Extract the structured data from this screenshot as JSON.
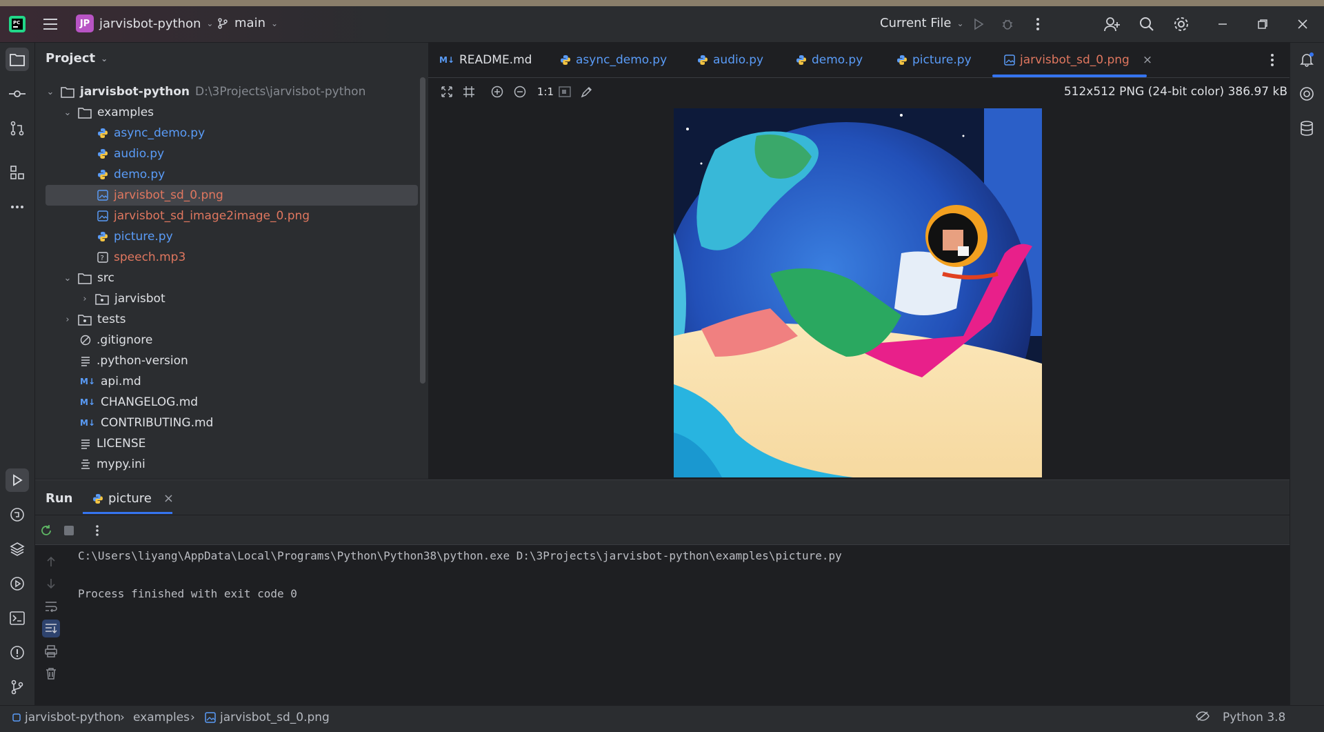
{
  "titlebar": {
    "project_badge": "JP",
    "project_name": "jarvisbot-python",
    "branch": "main",
    "run_config": "Current File"
  },
  "project_panel": {
    "title": "Project",
    "root": {
      "name": "jarvisbot-python",
      "path": "D:\\3Projects\\jarvisbot-python"
    },
    "items": [
      {
        "label": "examples"
      },
      {
        "label": "async_demo.py"
      },
      {
        "label": "audio.py"
      },
      {
        "label": "demo.py"
      },
      {
        "label": "jarvisbot_sd_0.png"
      },
      {
        "label": "jarvisbot_sd_image2image_0.png"
      },
      {
        "label": "picture.py"
      },
      {
        "label": "speech.mp3"
      },
      {
        "label": "src"
      },
      {
        "label": "jarvisbot"
      },
      {
        "label": "tests"
      },
      {
        "label": ".gitignore"
      },
      {
        "label": ".python-version"
      },
      {
        "label": "api.md"
      },
      {
        "label": "CHANGELOG.md"
      },
      {
        "label": "CONTRIBUTING.md"
      },
      {
        "label": "LICENSE"
      },
      {
        "label": "mypy.ini"
      }
    ]
  },
  "tabs": [
    {
      "label": "README.md"
    },
    {
      "label": "async_demo.py"
    },
    {
      "label": "audio.py"
    },
    {
      "label": "demo.py"
    },
    {
      "label": "picture.py"
    },
    {
      "label": "jarvisbot_sd_0.png"
    }
  ],
  "image_viewer": {
    "zoom_label": "1:1",
    "info": "512x512 PNG (24-bit color) 386.97 kB"
  },
  "run_panel": {
    "title": "Run",
    "tab_label": "picture",
    "console": [
      "C:\\Users\\liyang\\AppData\\Local\\Programs\\Python\\Python38\\python.exe D:\\3Projects\\jarvisbot-python\\examples\\picture.py",
      "",
      "Process finished with exit code 0"
    ]
  },
  "statusbar": {
    "breadcrumbs": [
      "jarvisbot-python",
      "examples",
      "jarvisbot_sd_0.png"
    ],
    "interpreter": "Python 3.8"
  },
  "colors": {
    "accent": "#3574f0",
    "modified_file": "#e0775f",
    "python_file": "#5a9cf8",
    "project_badge": "#b854c4"
  }
}
